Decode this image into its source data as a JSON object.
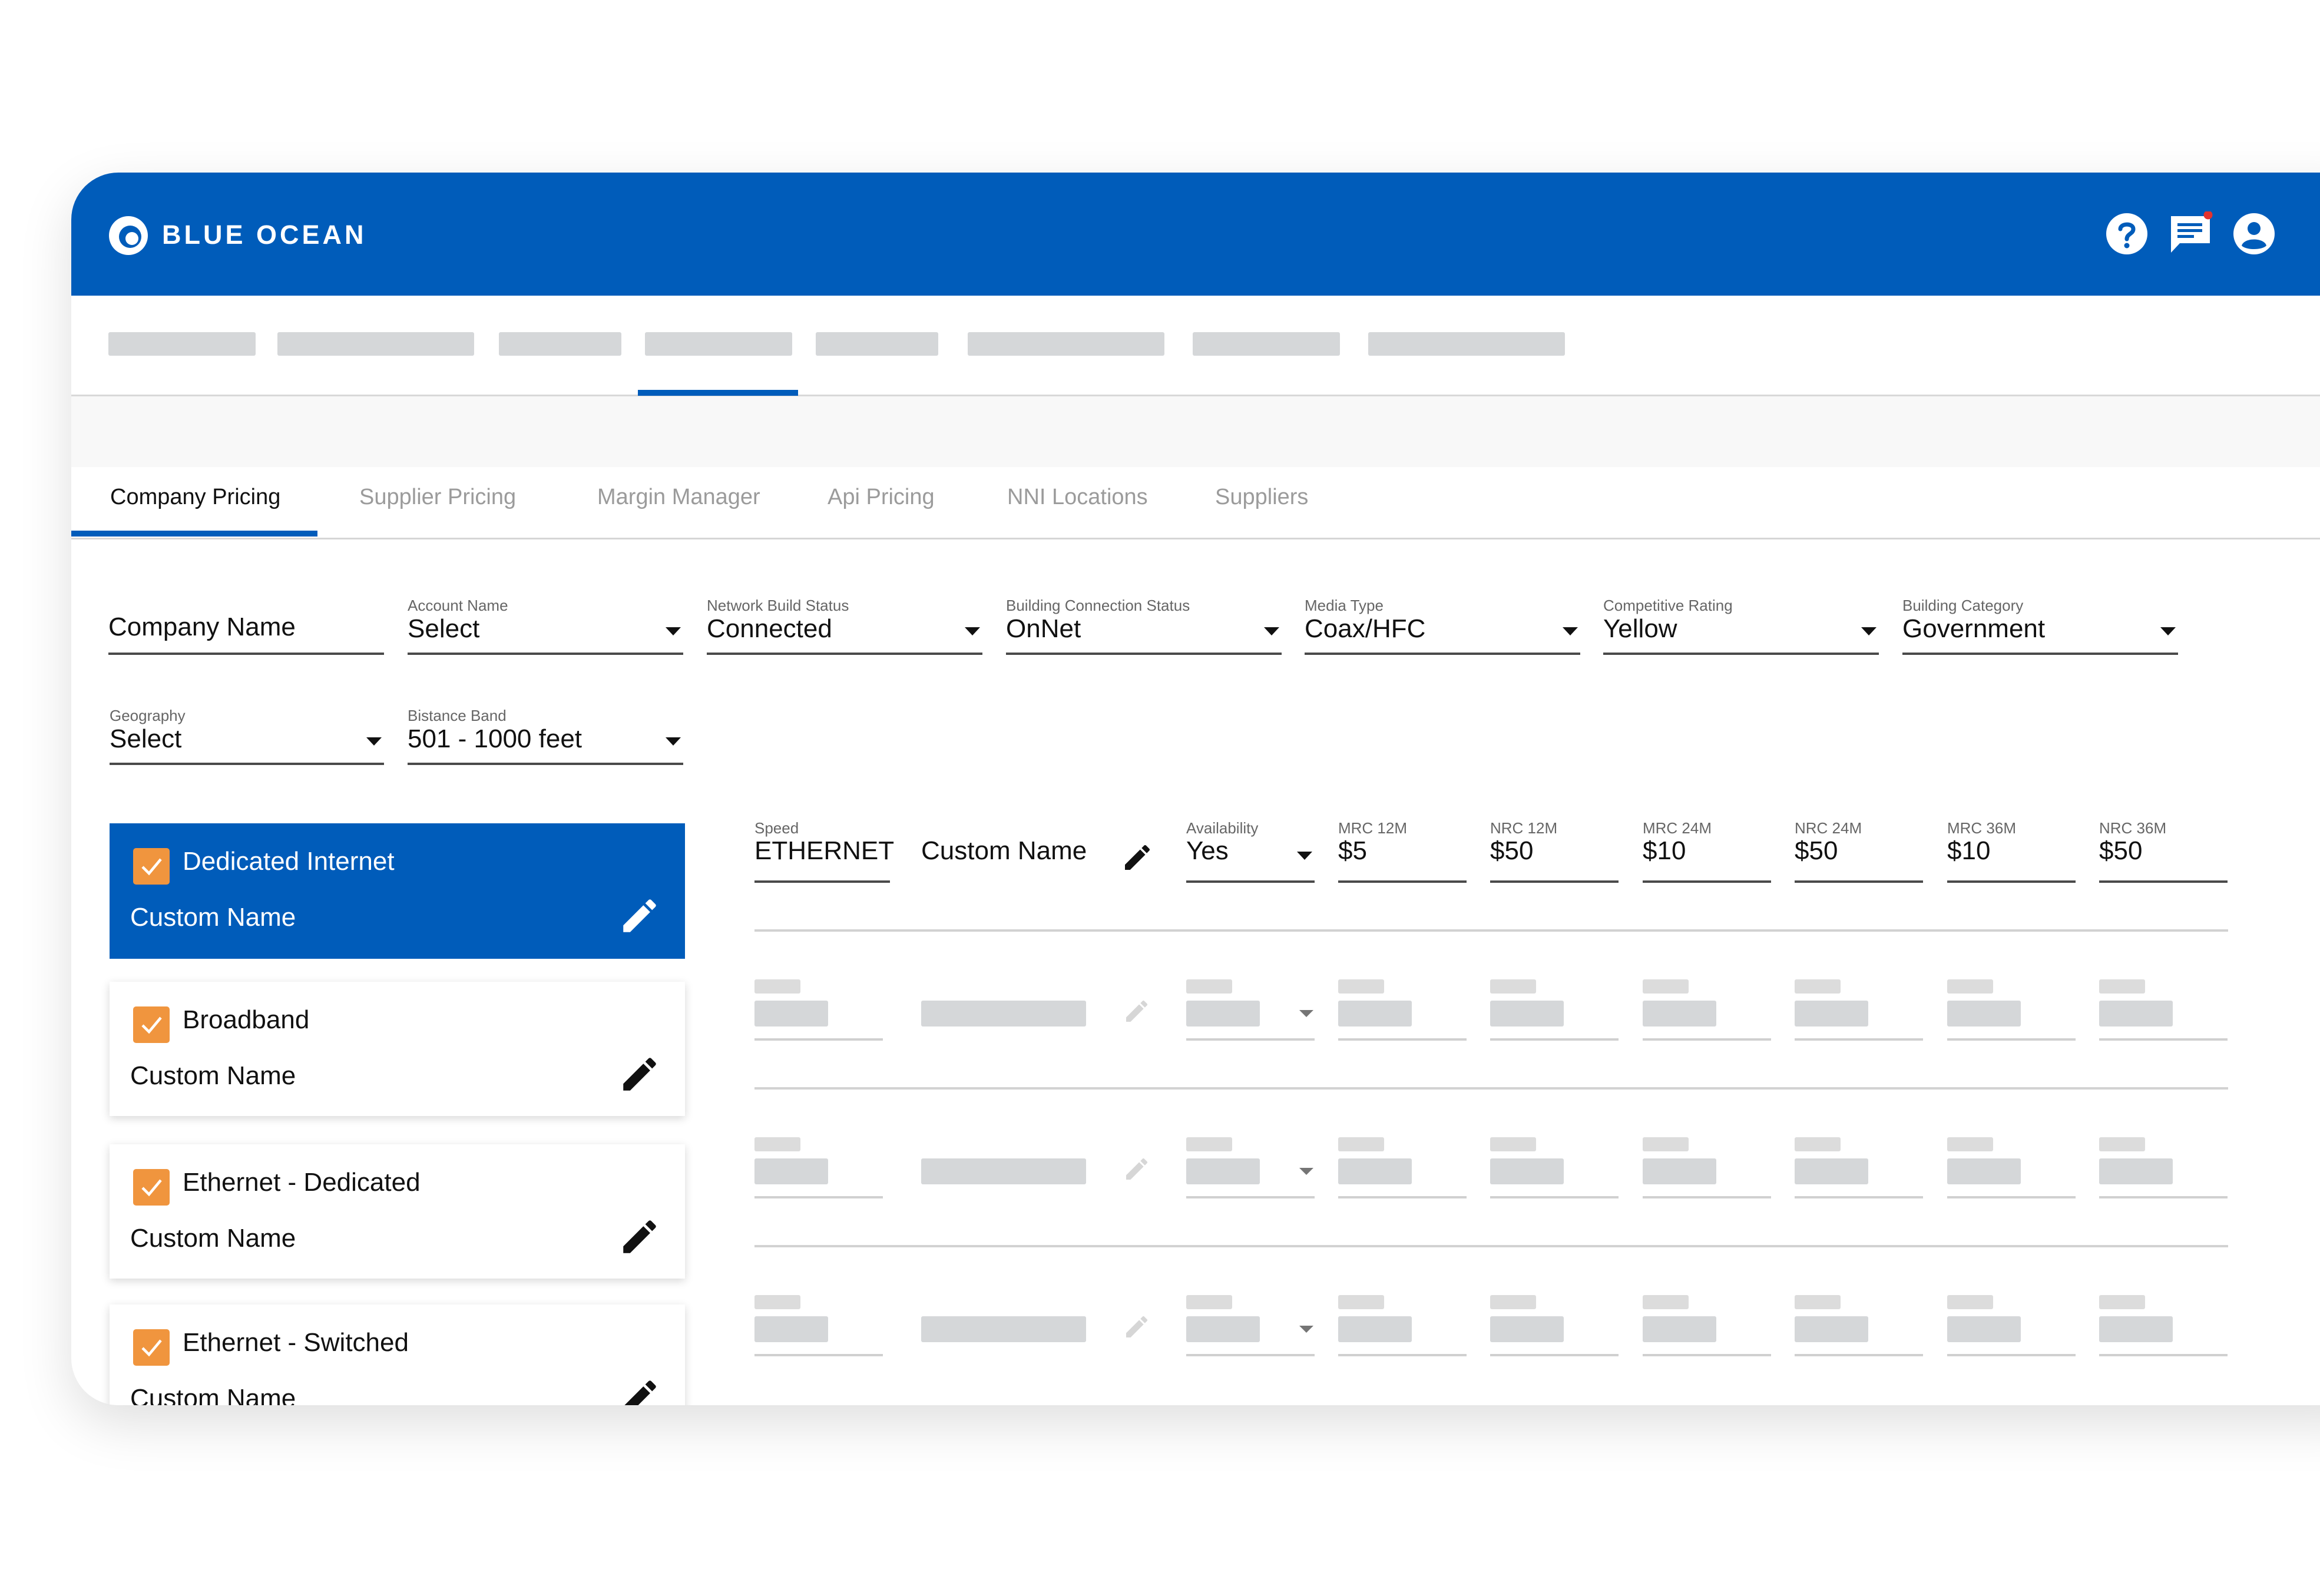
{
  "colors": {
    "brand": "#005cba",
    "accent": "#f0953e",
    "notification_dot": "#e5322d"
  },
  "header": {
    "brand_name": "BLUE OCEAN",
    "icons": [
      "help-icon",
      "chat-icon",
      "account-icon"
    ]
  },
  "nav": {
    "placeholder_count": 8,
    "active_index": 3
  },
  "tabs": [
    {
      "label": "Company Pricing",
      "active": true
    },
    {
      "label": "Supplier Pricing",
      "active": false
    },
    {
      "label": "Margin Manager",
      "active": false
    },
    {
      "label": "Api Pricing",
      "active": false
    },
    {
      "label": "NNI Locations",
      "active": false
    },
    {
      "label": "Suppliers",
      "active": false
    }
  ],
  "filters": {
    "company_name": {
      "value": "Company Name"
    },
    "account_name": {
      "label": "Account Name",
      "value": "Select"
    },
    "network_build_status": {
      "label": "Network Build Status",
      "value": "Connected"
    },
    "building_connection_status": {
      "label": "Building Connection Status",
      "value": "OnNet"
    },
    "media_type": {
      "label": "Media Type",
      "value": "Coax/HFC"
    },
    "competitive_rating": {
      "label": "Competitive Rating",
      "value": "Yellow"
    },
    "building_category": {
      "label": "Building Category",
      "value": "Government"
    },
    "geography": {
      "label": "Geography",
      "value": "Select"
    },
    "distance_band": {
      "label": "Bistance Band",
      "value": "501 - 1000 feet"
    }
  },
  "products": [
    {
      "title": "Dedicated Internet",
      "subtitle": "Custom Name",
      "checked": true,
      "active": true
    },
    {
      "title": "Broadband",
      "subtitle": "Custom Name",
      "checked": true,
      "active": false
    },
    {
      "title": "Ethernet - Dedicated",
      "subtitle": "Custom Name",
      "checked": true,
      "active": false
    },
    {
      "title": "Ethernet - Switched",
      "subtitle": "Custom Name",
      "checked": true,
      "active": false
    }
  ],
  "pricing_row": {
    "speed": {
      "label": "Speed",
      "value": "ETHERNET"
    },
    "custom_name": "Custom Name",
    "availability": {
      "label": "Availability",
      "value": "Yes"
    },
    "mrc_12m": {
      "label": "MRC 12M",
      "value": "$5"
    },
    "nrc_12m": {
      "label": "NRC 12M",
      "value": "$50"
    },
    "mrc_24m": {
      "label": "MRC 24M",
      "value": "$10"
    },
    "nrc_24m": {
      "label": "NRC 24M",
      "value": "$50"
    },
    "mrc_36m": {
      "label": "MRC 36M",
      "value": "$10"
    },
    "nrc_36m": {
      "label": "NRC 36M",
      "value": "$50"
    }
  },
  "placeholder_rows": 3
}
